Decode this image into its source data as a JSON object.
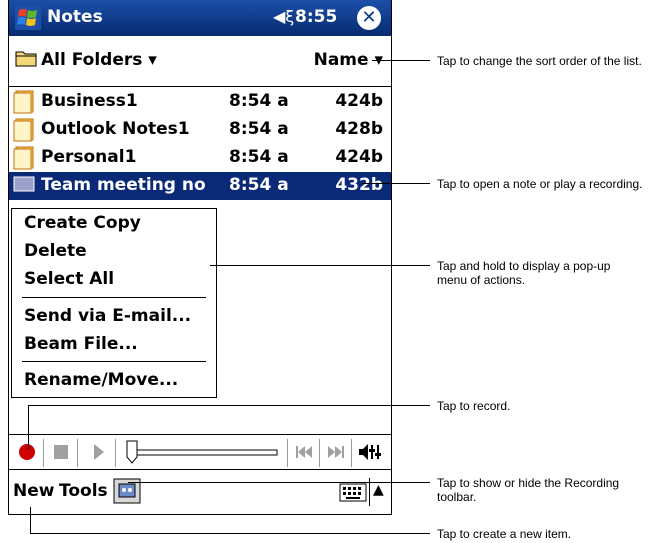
{
  "app": {
    "title": "Notes",
    "clock": "8:55",
    "logo_icon": "windows-flag-icon",
    "volume_icon": "speaker-icon",
    "close_icon": "close-icon"
  },
  "folder_bar": {
    "folder": "All Folders",
    "sort": "Name"
  },
  "notes": [
    {
      "name": "Business1",
      "time": "8:54 a",
      "size": "424b"
    },
    {
      "name": "Outlook Notes1",
      "time": "8:54 a",
      "size": "428b"
    },
    {
      "name": "Personal1",
      "time": "8:54 a",
      "size": "424b"
    },
    {
      "name": "Team meeting no",
      "time": "8:54 a",
      "size": "432b"
    }
  ],
  "popup_menu": [
    "Create Copy",
    "Delete",
    "Select All",
    "Send via E-mail...",
    "Beam File...",
    "Rename/Move..."
  ],
  "command_bar": {
    "new": "New",
    "tools": "Tools"
  },
  "callouts": {
    "sort": "Tap to change the sort order of the list.",
    "open": "Tap to open a note or play a recording.",
    "hold": "Tap and hold to display a pop-up menu of actions.",
    "record": "Tap to record.",
    "toggle": "Tap to show or hide the Recording toolbar.",
    "new": "Tap to create a new item."
  },
  "colors": {
    "titlebar": "#0a3a8c",
    "selection": "#0a2a78",
    "record": "#cc0000"
  }
}
